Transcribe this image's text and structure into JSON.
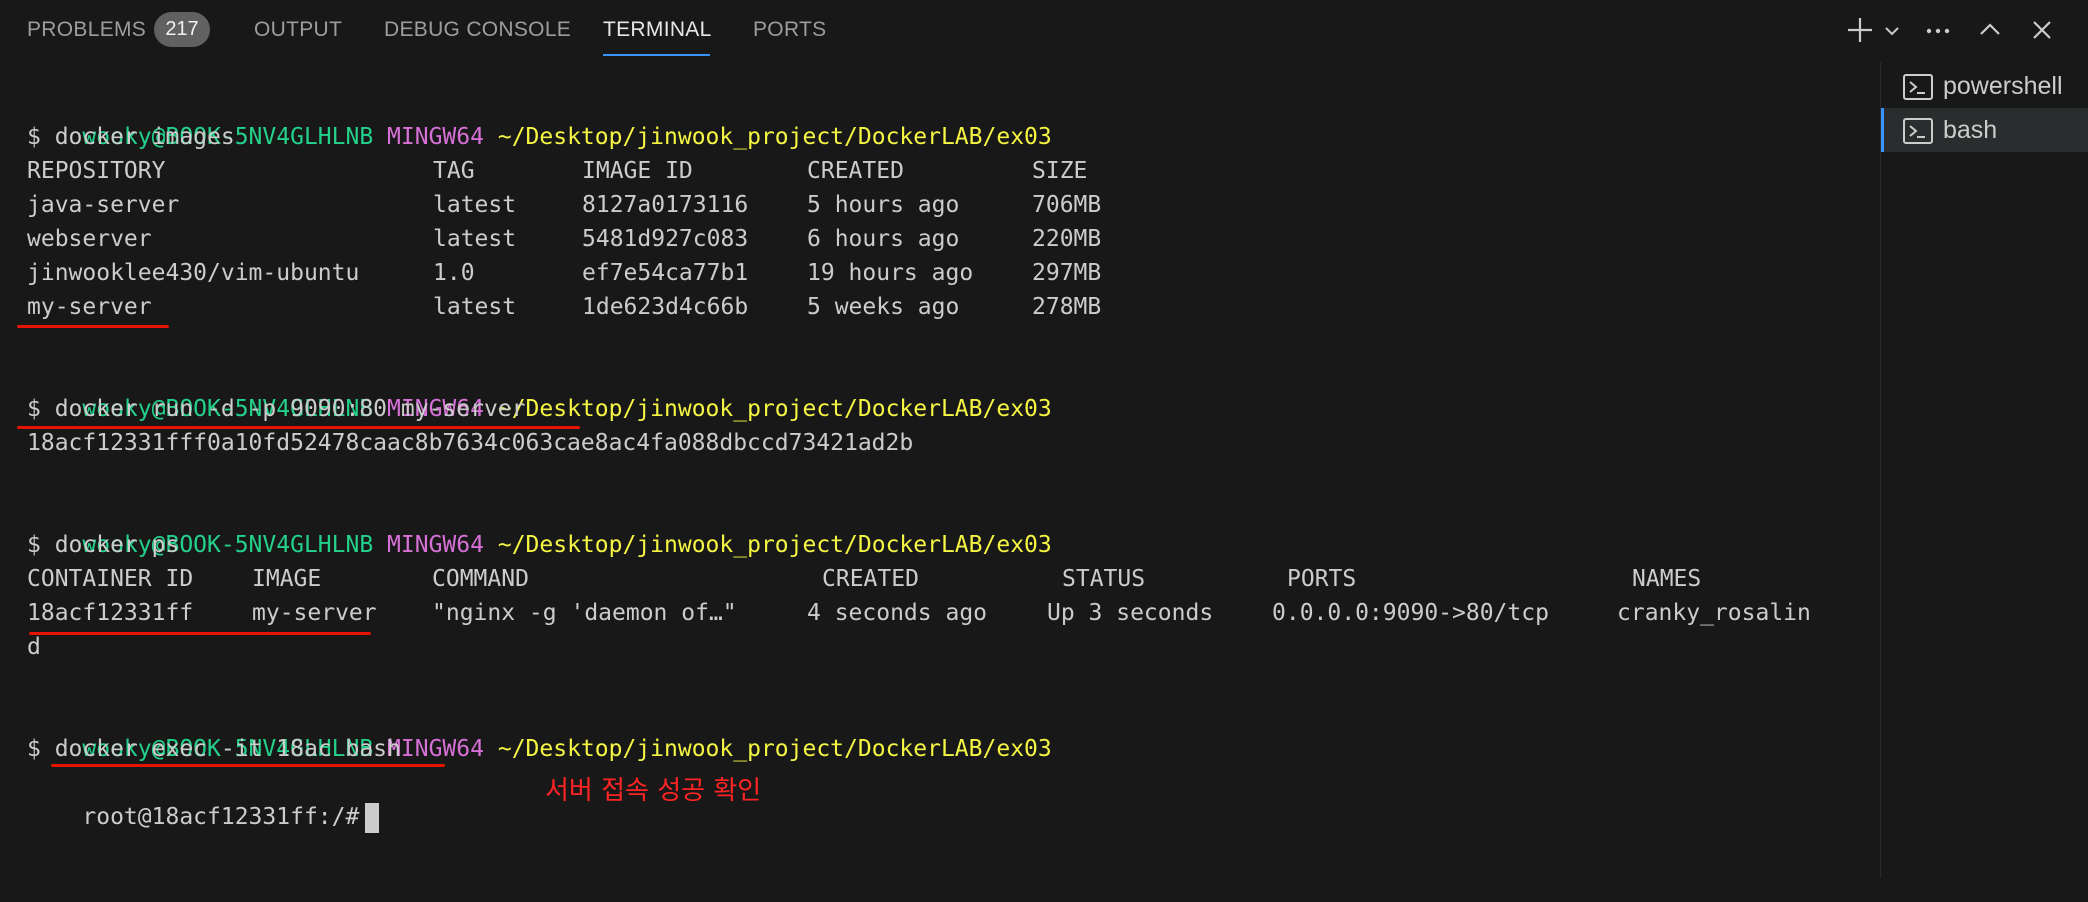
{
  "panel_tabs": {
    "problems": "PROBLEMS",
    "problems_count": "217",
    "output": "OUTPUT",
    "debug_console": "DEBUG CONSOLE",
    "terminal": "TERMINAL",
    "ports": "PORTS"
  },
  "actions": [
    "new-terminal",
    "launch-profile",
    "more-actions",
    "maximize-panel",
    "close-panel"
  ],
  "prompt": {
    "user_host": "wooky@BOOK-5NV4GLHLNB",
    "env": "MINGW64",
    "path": "~/Desktop/jinwook_project/DockerLAB/ex03"
  },
  "commands": {
    "c1": "$ docker images",
    "c2": "$ docker run -d -p 9090:80 my-server",
    "c3": "$ docker ps",
    "c4": "$ docker exec -it 18ac bash"
  },
  "images_table": {
    "headers": [
      "REPOSITORY",
      "TAG",
      "IMAGE ID",
      "CREATED",
      "SIZE"
    ],
    "rows": [
      [
        "java-server",
        "latest",
        "8127a0173116",
        "5 hours ago",
        "706MB"
      ],
      [
        "webserver",
        "latest",
        "5481d927c083",
        "6 hours ago",
        "220MB"
      ],
      [
        "jinwooklee430/vim-ubuntu",
        "1.0",
        "ef7e54ca77b1",
        "19 hours ago",
        "297MB"
      ],
      [
        "my-server",
        "latest",
        "1de623d4c66b",
        "5 weeks ago",
        "278MB"
      ]
    ]
  },
  "run_output": "18acf12331fff0a10fd52478caac8b7634c063cae8ac4fa088dbccd73421ad2b",
  "ps_table": {
    "headers": [
      "CONTAINER ID",
      "IMAGE",
      "COMMAND",
      "CREATED",
      "STATUS",
      "PORTS",
      "NAMES"
    ],
    "row": [
      "18acf12331ff",
      "my-server",
      "\"nginx -g 'daemon of…\"",
      "4 seconds ago",
      "Up 3 seconds",
      "0.0.0.0:9090->80/tcp",
      "cranky_rosalin"
    ],
    "wrap": "d"
  },
  "shell_prompt": "root@18acf12331ff:/#",
  "annotation": "서버 접속 성공 확인",
  "sessions": [
    {
      "label": "powershell",
      "active": false
    },
    {
      "label": "bash",
      "active": true
    }
  ],
  "colors": {
    "background": "#181818",
    "user_host": "#23d18b",
    "env": "#d670d6",
    "path": "#f5f543",
    "underline": "#e51400",
    "annotation": "#ff2424",
    "accent": "#3794ff"
  }
}
